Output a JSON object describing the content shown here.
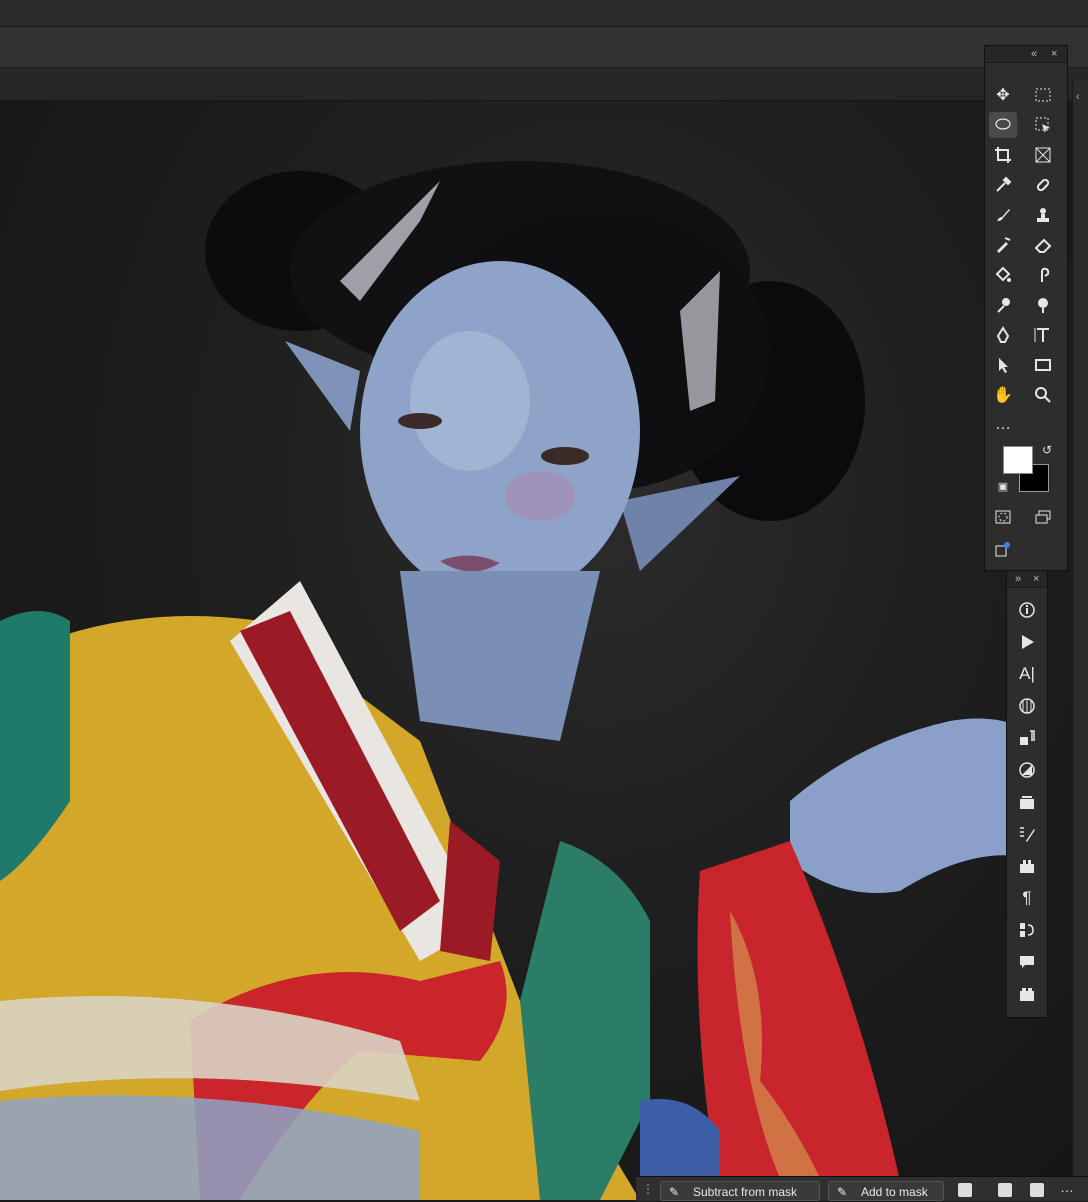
{
  "toolbar": {
    "tools": [
      {
        "name": "move-tool",
        "glyph": "✥"
      },
      {
        "name": "marquee-tool",
        "glyph": "⬚"
      },
      {
        "name": "lasso-tool",
        "glyph": "◌"
      },
      {
        "name": "object-select-tool",
        "glyph": "⬚"
      },
      {
        "name": "crop-tool",
        "glyph": "⌗"
      },
      {
        "name": "frame-tool",
        "glyph": "⊠"
      },
      {
        "name": "eyedropper-tool",
        "glyph": "⁄"
      },
      {
        "name": "healing-brush-tool",
        "glyph": "✚"
      },
      {
        "name": "brush-tool",
        "glyph": "✎"
      },
      {
        "name": "clone-stamp-tool",
        "glyph": "⊥"
      },
      {
        "name": "history-brush-tool",
        "glyph": "↺"
      },
      {
        "name": "eraser-tool",
        "glyph": "⌫"
      },
      {
        "name": "paint-bucket-tool",
        "glyph": "◈"
      },
      {
        "name": "smudge-tool",
        "glyph": "☝"
      },
      {
        "name": "dodge-tool",
        "glyph": "◐"
      },
      {
        "name": "zoom-tool",
        "glyph": "⚲"
      },
      {
        "name": "pen-tool",
        "glyph": "✒"
      },
      {
        "name": "type-tool",
        "glyph": "T"
      },
      {
        "name": "path-select-tool",
        "glyph": "➤"
      },
      {
        "name": "rectangle-tool",
        "glyph": "▭"
      },
      {
        "name": "hand-tool",
        "glyph": "✋"
      },
      {
        "name": "zoom-tool-2",
        "glyph": "⚲"
      },
      {
        "name": "more-tools",
        "glyph": "•••"
      }
    ],
    "foreground_color": "#ffffff",
    "background_color": "#000000"
  },
  "actions_panel": {
    "icons": [
      "info-icon",
      "play-icon",
      "character-icon",
      "glyphs-icon",
      "paragraph-styles-icon",
      "adjustments-icon",
      "libraries-icon",
      "brush-settings-icon",
      "properties-icon",
      "paragraph-icon",
      "clone-source-icon",
      "comments-icon",
      "layer-comps-icon"
    ]
  },
  "bottom_bar": {
    "subtract_label": "Subtract from mask",
    "add_label": "Add to mask"
  }
}
